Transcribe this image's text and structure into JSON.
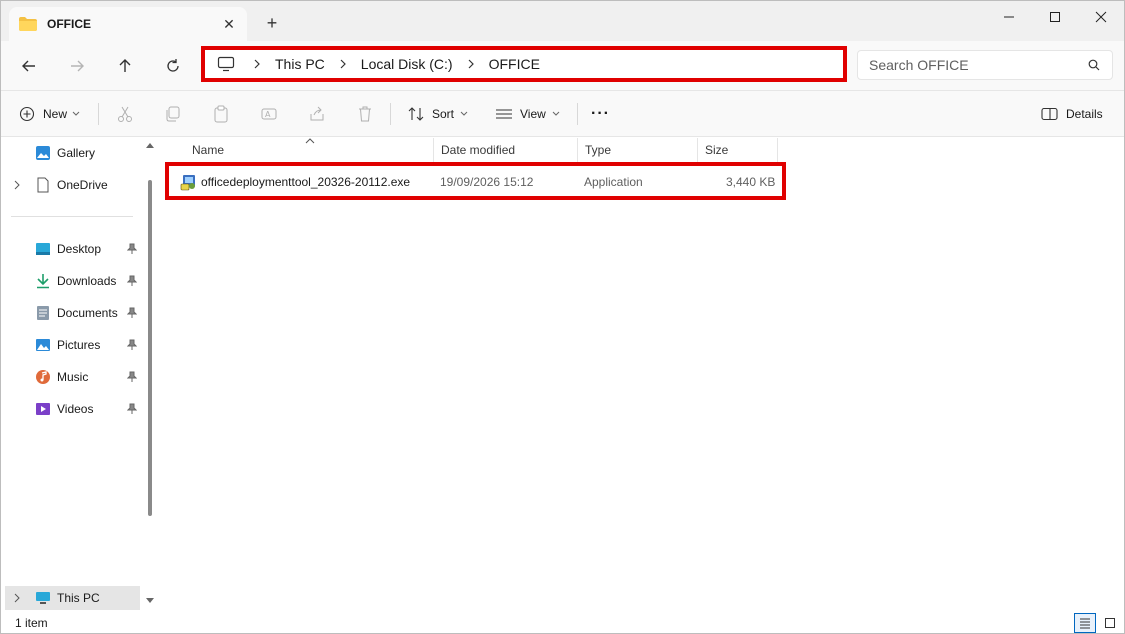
{
  "window": {
    "tab_title": "OFFICE",
    "new_tab": "+",
    "close_tab": "✕"
  },
  "address": {
    "crumbs": [
      "This PC",
      "Local Disk (C:)",
      "OFFICE"
    ]
  },
  "search": {
    "placeholder": "Search OFFICE"
  },
  "toolbar": {
    "new_label": "New",
    "sort_label": "Sort",
    "view_label": "View",
    "more_label": "···",
    "details_label": "Details"
  },
  "sidebar": {
    "items": [
      {
        "label": "Gallery"
      },
      {
        "label": "OneDrive"
      },
      {
        "label": "Desktop"
      },
      {
        "label": "Downloads"
      },
      {
        "label": "Documents"
      },
      {
        "label": "Pictures"
      },
      {
        "label": "Music"
      },
      {
        "label": "Videos"
      },
      {
        "label": "This PC"
      }
    ]
  },
  "columns": [
    "Name",
    "Date modified",
    "Type",
    "Size"
  ],
  "files": [
    {
      "name": "officedeploymenttool_20326-20112.exe",
      "date": "19/09/2026 15:12",
      "type": "Application",
      "size": "3,440 KB"
    }
  ],
  "status": {
    "count": "1 item"
  },
  "colors": {
    "highlight": "#e00000",
    "accent": "#0067c0"
  }
}
